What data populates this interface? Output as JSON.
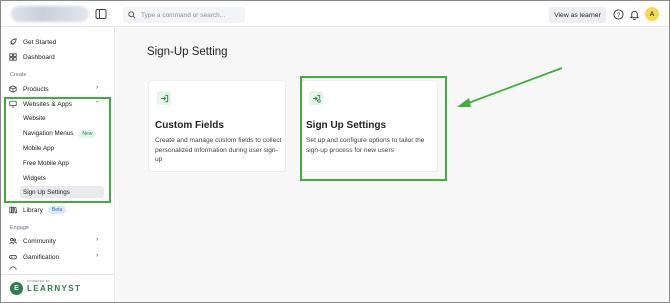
{
  "topbar": {
    "search_placeholder": "Type a command or search...",
    "view_as_learner": "View as learner",
    "avatar_initial": "A"
  },
  "sidebar": {
    "items": [
      {
        "label": "Get Started",
        "icon": "rocket-icon"
      },
      {
        "label": "Dashboard",
        "icon": "grid-icon"
      }
    ],
    "section_create": "Create",
    "products": "Products",
    "websites_apps": "Websites & Apps",
    "sub_items": [
      "Website",
      "Navigation Menus",
      "Mobile App",
      "Free Mobile App",
      "Widgets",
      "Sign Up Settings"
    ],
    "new_badge": "New",
    "library": "Library",
    "beta_badge": "Beta",
    "section_engage": "Engage",
    "community": "Community",
    "gamification": "Gamification",
    "brand_pre": "POWERED BY",
    "brand": "LEARNYST"
  },
  "main": {
    "title": "Sign-Up Setting",
    "cards": [
      {
        "title": "Custom Fields",
        "desc": "Create and manage custom fields to collect personalized information during user sign-up"
      },
      {
        "title": "Sign Up Settings",
        "desc": "Set up and configure options to tailor the sign-up process for new users"
      }
    ]
  },
  "colors": {
    "highlight": "#3fae3a",
    "brand": "#2e7d4f",
    "active_bg": "#e8eaee"
  }
}
